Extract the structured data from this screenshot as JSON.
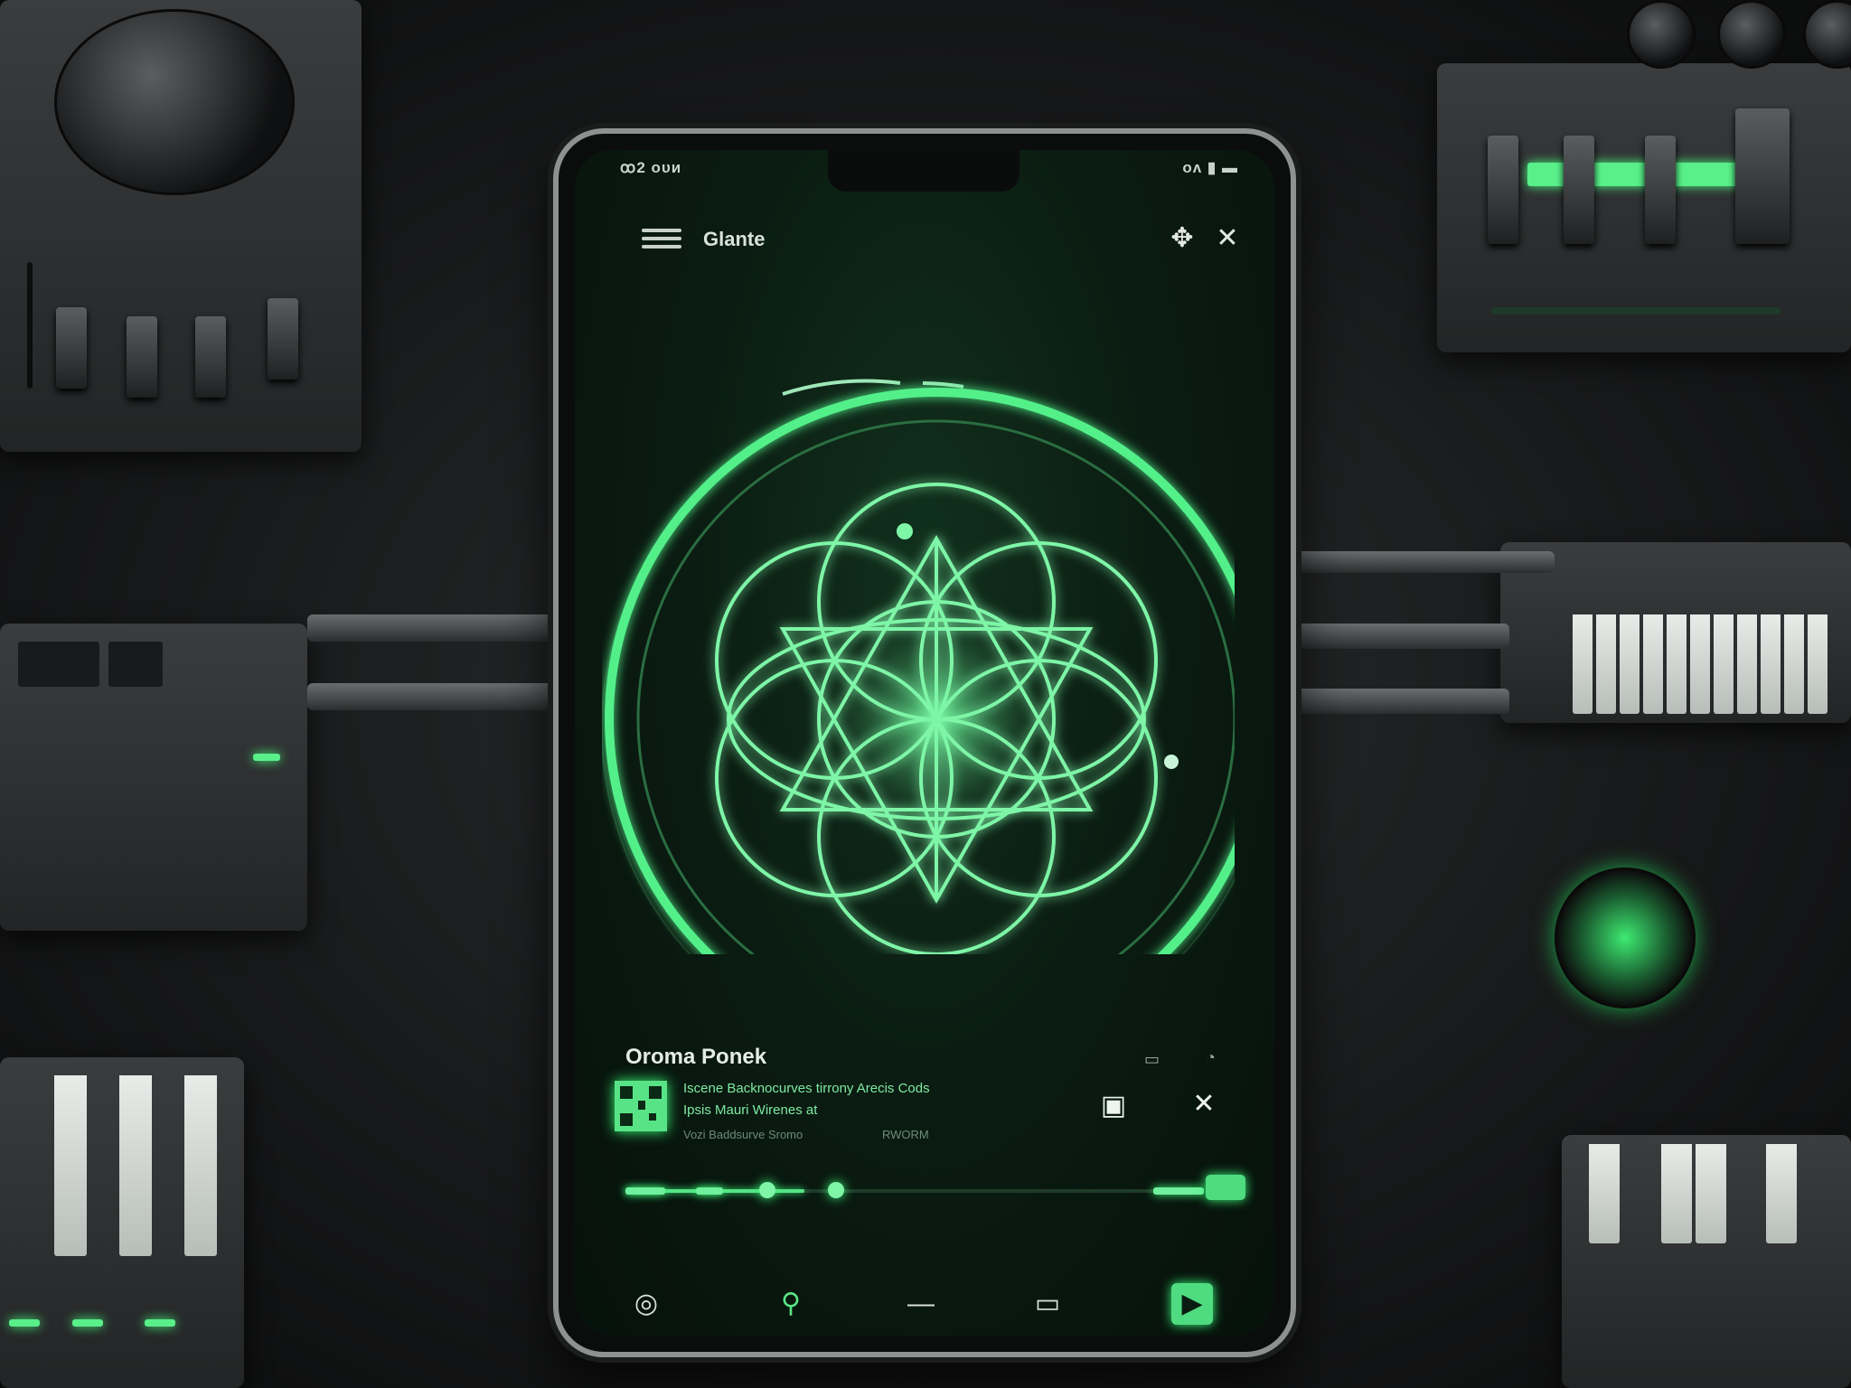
{
  "status_bar": {
    "left_text": "ꝏ2 ᴏᴜᴎ",
    "right_text": "ᴏᴧ ▮ ▬"
  },
  "app_bar": {
    "title": "Glante",
    "menu_icon": "hamburger-menu-icon",
    "actions": [
      "bluetooth-icon",
      "close-icon"
    ]
  },
  "now_playing": {
    "track_title": "Oroma Ponek",
    "line1": "Iscene Backnocurves tirrony Arecis Cods",
    "line2": "Ipsis Mauri Wirenes at",
    "line3": "Vozi Baddsurve Sromo",
    "line3_right": "RWORM",
    "header_icons": [
      "cast-icon",
      "timer-icon"
    ],
    "actions": [
      "album-card-icon",
      "shuffle-cross-icon"
    ],
    "progress": 0.31
  },
  "bottom_nav": {
    "items": [
      "home-icon",
      "search-icon",
      "divider",
      "library-icon",
      "play-icon"
    ],
    "active": "play-icon"
  },
  "colors": {
    "accent": "#58e486",
    "accent_glow": "#37ff77",
    "screen_dark": "#06110b",
    "text": "#e5ece8"
  }
}
